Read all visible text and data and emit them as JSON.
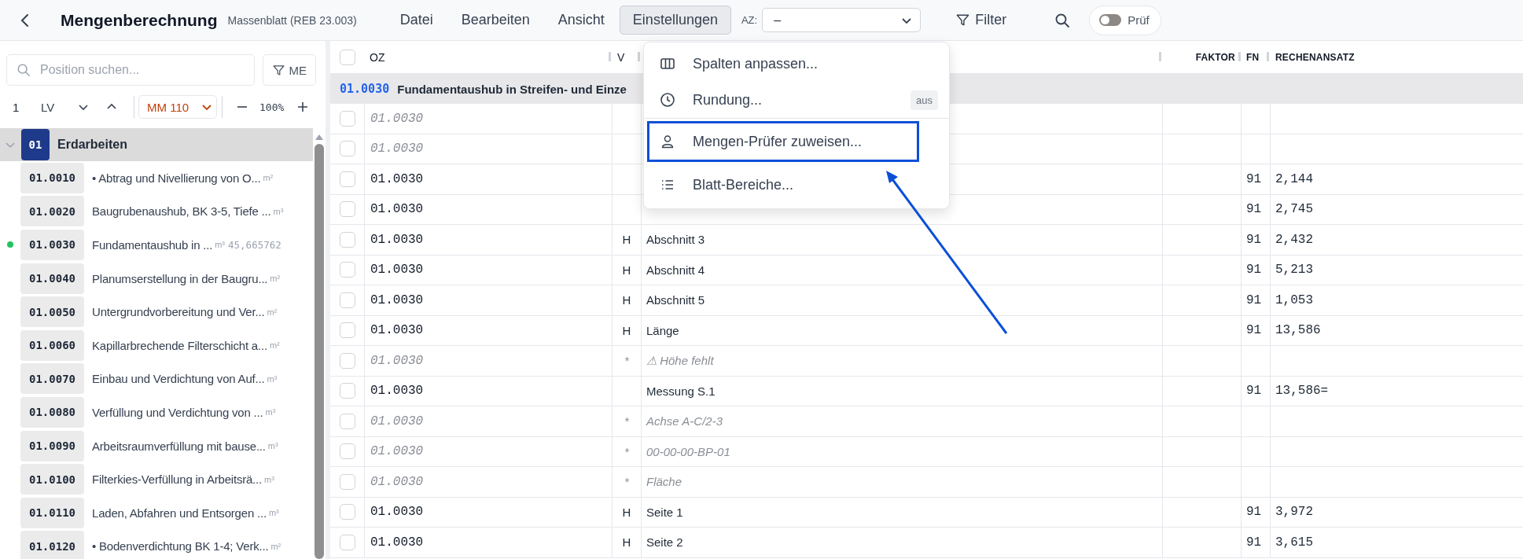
{
  "app": {
    "title": "Mengenberechnung",
    "subtitle": "Massenblatt (REB 23.003)"
  },
  "menus": [
    {
      "label": "Datei",
      "selected": false
    },
    {
      "label": "Bearbeiten",
      "selected": false
    },
    {
      "label": "Ansicht",
      "selected": false
    },
    {
      "label": "Einstellungen",
      "selected": true
    }
  ],
  "az": {
    "label": "AZ:",
    "value": "–"
  },
  "filter": {
    "label": "Filter"
  },
  "pruef": {
    "label": "Prüf",
    "on": false
  },
  "dropdown": {
    "groups": [
      [
        {
          "label": "Spalten anpassen...",
          "highlighted": false
        },
        {
          "label": "Rundung...",
          "badge": "aus",
          "highlighted": false
        }
      ],
      [
        {
          "label": "Mengen-Prüfer zuweisen...",
          "highlighted": true
        },
        {
          "label": "Blatt-Bereiche...",
          "highlighted": false
        }
      ]
    ]
  },
  "sidebar": {
    "search": {
      "placeholder": "Position suchen..."
    },
    "filter_button": "ME",
    "nav": {
      "index": "1",
      "scope": "LV",
      "mode": "MM 110",
      "zoom": "100%"
    },
    "tree": {
      "code": "01",
      "label": "Erdarbeiten",
      "expanded": true,
      "children": [
        {
          "code": "01.0010",
          "label": "• Abtrag und Nivellierung von O...",
          "unit": "m²",
          "marked": false
        },
        {
          "code": "01.0020",
          "label": "Baugrubenaushub, BK 3-5, Tiefe ...",
          "unit": "m³",
          "marked": false
        },
        {
          "code": "01.0030",
          "label": "Fundamentaushub in ...",
          "unit": "m³",
          "amount": "45,665762",
          "marked": true
        },
        {
          "code": "01.0040",
          "label": "Planumserstellung in der Baugru...",
          "unit": "m²",
          "marked": false
        },
        {
          "code": "01.0050",
          "label": "Untergrundvorbereitung und Ver...",
          "unit": "m²",
          "marked": false
        },
        {
          "code": "01.0060",
          "label": "Kapillarbrechende Filterschicht a...",
          "unit": "m²",
          "marked": false
        },
        {
          "code": "01.0070",
          "label": "Einbau und Verdichtung von Auf...",
          "unit": "m³",
          "marked": false
        },
        {
          "code": "01.0080",
          "label": "Verfüllung und Verdichtung von ...",
          "unit": "m³",
          "marked": false
        },
        {
          "code": "01.0090",
          "label": "Arbeitsraumverfüllung mit bause...",
          "unit": "m³",
          "marked": false
        },
        {
          "code": "01.0100",
          "label": "Filterkies-Verfüllung in Arbeitsrä...",
          "unit": "m³",
          "marked": false
        },
        {
          "code": "01.0110",
          "label": "Laden, Abfahren und Entsorgen ...",
          "unit": "m³",
          "marked": false
        },
        {
          "code": "01.0120",
          "label": "• Bodenverdichtung BK 1-4; Verk...",
          "unit": "m²",
          "marked": false
        }
      ]
    }
  },
  "table": {
    "header": {
      "checked": false,
      "oz": "OZ",
      "v": "V",
      "faktor": "FAKTOR",
      "fn": "FN",
      "rechenansatz": "RECHENANSATZ"
    },
    "group": {
      "oz": "01.0030",
      "title": "Fundamentaushub in Streifen- und Einze"
    },
    "rows": [
      {
        "kind": "comment",
        "checked": false,
        "oz": "01.0030"
      },
      {
        "kind": "comment",
        "checked": false,
        "oz": "01.0030"
      },
      {
        "kind": "entry",
        "checked": false,
        "oz": "01.0030",
        "fn": "91",
        "value": "2,144"
      },
      {
        "kind": "entry",
        "checked": false,
        "oz": "01.0030",
        "fn": "91",
        "value": "2,745"
      },
      {
        "kind": "entry",
        "checked": false,
        "oz": "01.0030",
        "v": "H",
        "text": "Abschnitt 3",
        "fn": "91",
        "value": "2,432"
      },
      {
        "kind": "entry",
        "checked": false,
        "oz": "01.0030",
        "v": "H",
        "text": "Abschnitt 4",
        "fn": "91",
        "value": "5,213"
      },
      {
        "kind": "entry",
        "checked": false,
        "oz": "01.0030",
        "v": "H",
        "text": "Abschnitt 5",
        "fn": "91",
        "value": "1,053"
      },
      {
        "kind": "entry",
        "checked": false,
        "oz": "01.0030",
        "v": "H",
        "text": "Länge",
        "fn": "91",
        "value": "13,586"
      },
      {
        "kind": "comment",
        "checked": false,
        "oz": "01.0030",
        "v": "*",
        "text": "⚠ Höhe fehlt"
      },
      {
        "kind": "entry",
        "checked": false,
        "oz": "01.0030",
        "text": "Messung S.1",
        "fn": "91",
        "value": "13,586="
      },
      {
        "kind": "comment",
        "checked": false,
        "oz": "01.0030",
        "v": "*",
        "text": "Achse A-C/2-3"
      },
      {
        "kind": "comment",
        "checked": false,
        "oz": "01.0030",
        "v": "*",
        "text": "00-00-00-BP-01"
      },
      {
        "kind": "comment",
        "checked": false,
        "oz": "01.0030",
        "v": "*",
        "text": "Fläche"
      },
      {
        "kind": "entry",
        "checked": false,
        "oz": "01.0030",
        "v": "H",
        "text": "Seite 1",
        "fn": "91",
        "value": "3,972"
      },
      {
        "kind": "entry",
        "checked": false,
        "oz": "01.0030",
        "v": "H",
        "text": "Seite 2",
        "fn": "91",
        "value": "3,615"
      }
    ]
  }
}
